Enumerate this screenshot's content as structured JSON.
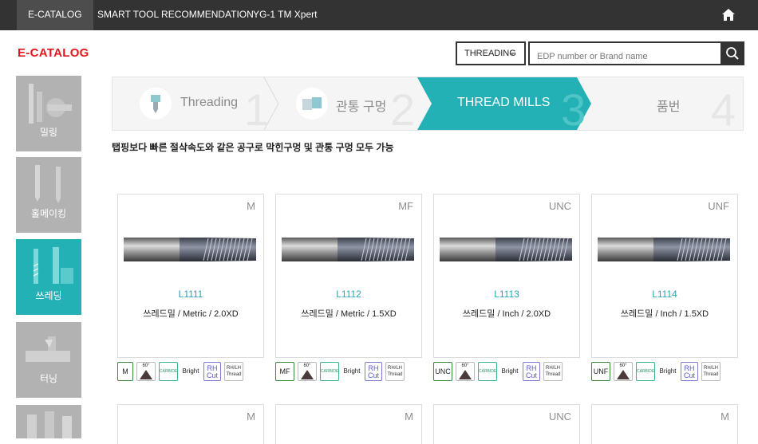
{
  "topnav": {
    "items": [
      "E-CATALOG",
      "SMART TOOL RECOMMENDATION",
      "YG-1 TM Xpert"
    ],
    "home_icon": "home-icon"
  },
  "logo": "E-CATALOG",
  "search": {
    "select_value": "THREADING",
    "placeholder": "EDP number or Brand name",
    "icon": "search-icon"
  },
  "sidebar": {
    "items": [
      {
        "label": "밀링"
      },
      {
        "label": "홀메이킹"
      },
      {
        "label": "쓰레딩",
        "active": true
      },
      {
        "label": "터닝"
      },
      {
        "label": ""
      }
    ]
  },
  "steps": [
    {
      "label": "Threading",
      "num": "1"
    },
    {
      "label": "관통 구멍",
      "num": "2"
    },
    {
      "label": "THREAD MILLS",
      "num": "3",
      "active": true
    },
    {
      "label": "품번",
      "num": "4"
    }
  ],
  "description": "탭핑보다 빠른 절삭속도와 같은 공구로 막힌구멍 및 관통 구멍 모두 가능",
  "products": [
    {
      "type": "M",
      "edp": "L1111",
      "name": "쓰레드밀 / Metric / 2.0XD"
    },
    {
      "type": "MF",
      "edp": "L1112",
      "name": "쓰레드밀 / Metric / 1.5XD"
    },
    {
      "type": "UNC",
      "edp": "L1113",
      "name": "쓰레드밀 / Inch / 2.0XD"
    },
    {
      "type": "UNF",
      "edp": "L1114",
      "name": "쓰레드밀 / Inch / 1.5XD"
    }
  ],
  "badges": {
    "angle": "60°",
    "carbide": "CARBIDE",
    "bright": "Bright",
    "rh_top": "RH",
    "rh_bottom": "Cut",
    "rhlh_top": "RH/LH",
    "rhlh_bottom": "Thread"
  },
  "next_row_types": [
    "M",
    "M",
    "UNC",
    "M"
  ],
  "colors": {
    "topnav_bg": "#333333",
    "accent_teal": "#23b1b5",
    "logo_red": "#e5161d",
    "sidebar_gray": "#b2b2b2"
  }
}
